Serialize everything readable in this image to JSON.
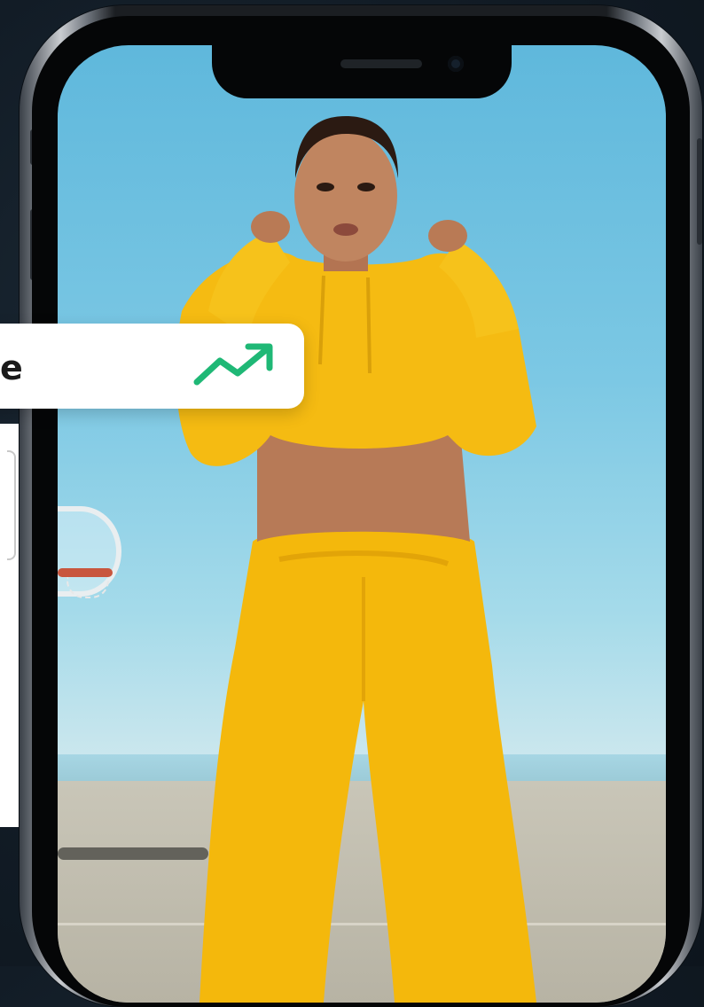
{
  "trend_card": {
    "label": "e",
    "icon": "trending-up-icon",
    "icon_color": "#1fb876"
  },
  "colors": {
    "background": "#121c26",
    "outfit": "#f5b90f"
  }
}
